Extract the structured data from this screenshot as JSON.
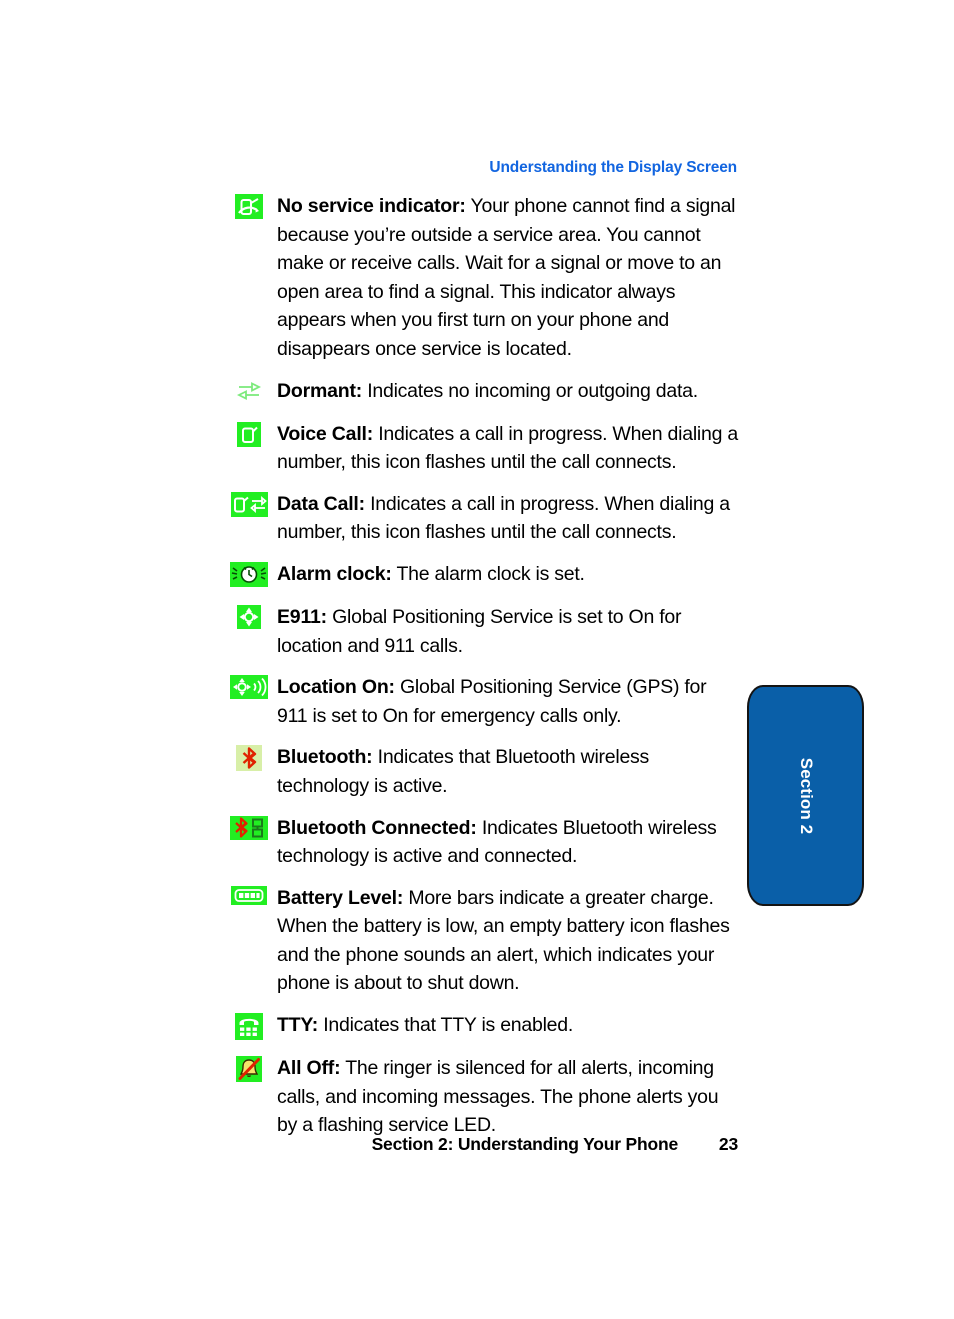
{
  "page": {
    "running_head": "Understanding the Display Screen",
    "footer_title": "Section 2: Understanding Your Phone",
    "page_number": "23",
    "accent_blue": "#1265e0",
    "tab_blue": "#0a5fa8",
    "icon_green": "#22ee22",
    "icon_pale_green": "#d8efa8",
    "icon_red": "#e02200"
  },
  "side_tab": {
    "label": "Section 2"
  },
  "entries": [
    {
      "icon": "no-service-indicator-icon",
      "term": "No service indicator:",
      "description": " Your phone cannot find a signal because you’re outside a service area. You cannot make or receive calls. Wait for a signal or move to an open area to find a signal. This indicator always appears when you first turn on your phone and disappears once service is located."
    },
    {
      "icon": "dormant-data-arrows-icon",
      "term": "Dormant:",
      "description": " Indicates no incoming or outgoing data."
    },
    {
      "icon": "voice-call-icon",
      "term": "Voice Call:",
      "description": " Indicates a call in progress. When dialing a number, this icon flashes until the call connects."
    },
    {
      "icon": "data-call-icon",
      "term": "Data Call:",
      "description": " Indicates a call in progress. When dialing a number, this icon flashes until the call connects."
    },
    {
      "icon": "alarm-clock-icon",
      "term": "Alarm clock:",
      "description": " The alarm clock is set."
    },
    {
      "icon": "e911-location-crosshair-icon",
      "term": "E911:",
      "description": " Global Positioning Service is set to On for location and 911 calls."
    },
    {
      "icon": "location-on-icon",
      "term": "Location On:",
      "description": " Global Positioning Service (GPS) for 911 is set to On for emergency calls only."
    },
    {
      "icon": "bluetooth-icon",
      "term": "Bluetooth:",
      "description": " Indicates that Bluetooth wireless technology is active."
    },
    {
      "icon": "bluetooth-connected-icon",
      "term": "Bluetooth Connected:",
      "description": " Indicates Bluetooth wireless technology is active and connected."
    },
    {
      "icon": "battery-level-icon",
      "term": "Battery Level:",
      "description": " More bars indicate a greater charge. When the battery is low, an empty battery icon flashes and the phone sounds an alert, which indicates your phone is about to shut down."
    },
    {
      "icon": "tty-icon",
      "term": "TTY:",
      "description": " Indicates that TTY is enabled."
    },
    {
      "icon": "all-off-ringer-silenced-icon",
      "term": "All Off:",
      "description": " The ringer is silenced for all alerts, incoming calls, and incoming messages. The phone alerts you by a flashing service LED."
    }
  ]
}
